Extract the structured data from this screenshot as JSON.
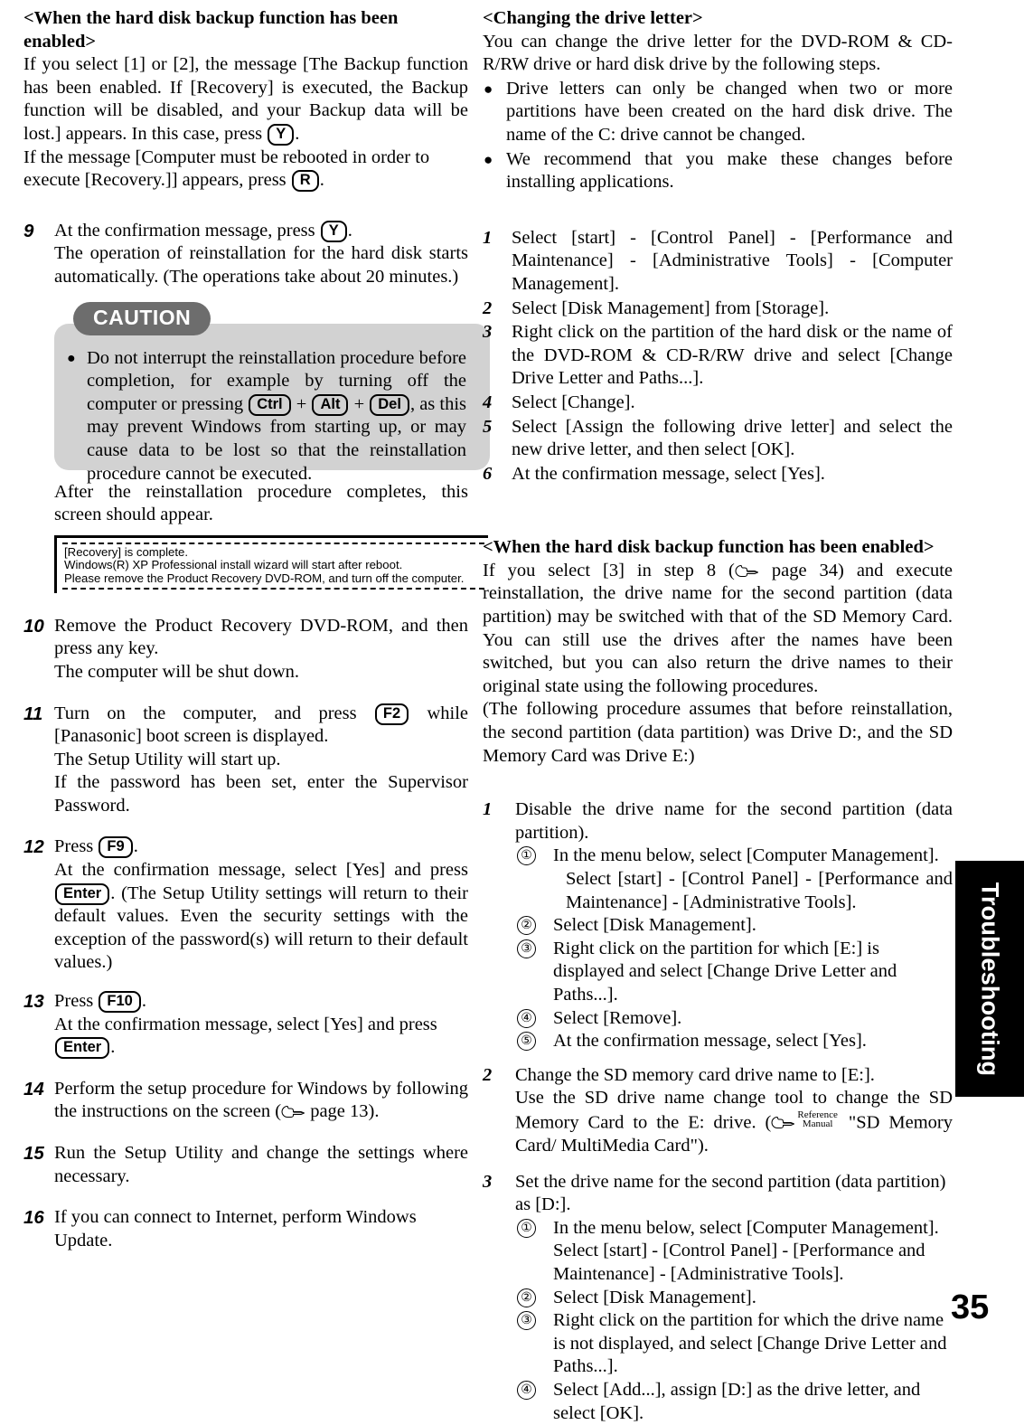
{
  "page": {
    "number": "35",
    "tab_label": "Troubleshooting"
  },
  "left_column": {
    "heading_backup_enabled": "<When the hard disk backup function has been enabled>",
    "p_backup_1a": "If you select [1] or [2], the message [The Backup function has been enabled. If [Recovery] is executed, the Backup function will be disabled, and your Backup data will be lost.] appears.  In this case, press ",
    "p_backup_1_key": "Y",
    "p_backup_1b": ".",
    "p_backup_2a": "If the message [Computer must be rebooted in order to execute [Recovery.]] appears, press ",
    "p_backup_2_key": "R",
    "p_backup_2b": ".",
    "steps": [
      {
        "num": "9",
        "text_a": "At the confirmation message, press ",
        "key": "Y",
        "text_b": ".",
        "text_c": "The operation of reinstallation for the hard disk starts automatically. (The operations take about 20 minutes.)"
      },
      {
        "num": "10",
        "text_a": "Remove the Product Recovery DVD-ROM, and then press any key.",
        "text_b": "The computer will be shut down."
      },
      {
        "num": "11",
        "text_a": "Turn on the computer, and press ",
        "key": "F2",
        "text_b": " while [Panasonic] boot screen is displayed.",
        "text_c": "The Setup Utility will start up.",
        "text_d": "If the password has been set, enter the Supervisor Password."
      },
      {
        "num": "12",
        "text_a": "Press ",
        "key": "F9",
        "text_b": ".",
        "text_c": "At the confirmation message, select [Yes] and press ",
        "key2": "Enter",
        "text_d": ".  (The Setup Utility settings will return to their default values.  Even the security settings with the exception of the password(s) will return to their default values.)"
      },
      {
        "num": "13",
        "text_a": "Press ",
        "key": "F10",
        "text_b": ".",
        "text_c": "At the confirmation message, select [Yes] and press ",
        "key2": "Enter",
        "text_d": "."
      },
      {
        "num": "14",
        "text_a": "Perform the setup procedure for Windows by following the instructions on the screen (",
        "ref_icon": "pointing-hand-icon",
        "text_b": " page 13)."
      },
      {
        "num": "15",
        "text_a": "Run the Setup Utility and change the settings where necessary."
      },
      {
        "num": "16",
        "text_a": "If you can connect to Internet, perform Windows Update."
      }
    ],
    "caution": {
      "badge": "CAUTION",
      "bullet": "●",
      "text_a": "Do not interrupt the reinstallation procedure before completion, for example by turning off the computer or pressing ",
      "key1": "Ctrl",
      "plus1": " + ",
      "key2": "Alt",
      "plus2": " + ",
      "key3": "Del",
      "text_b": ", as this may prevent Windows from starting up, or may cause data to be lost so that the reinstallation procedure cannot be executed."
    },
    "after_caution": "After the reinstallation procedure completes, this screen should appear.",
    "screen_box": {
      "line1": "[Recovery] is complete.",
      "line2": "Windows(R) XP Professional install wizard will start after reboot.",
      "line3": "Please remove the Product Recovery DVD-ROM, and turn off the computer."
    }
  },
  "right_column": {
    "heading_change_drive": "<Changing the drive letter>",
    "p_change_intro": "You can change the drive letter for the DVD-ROM & CD-R/RW drive or hard disk drive by the following steps.",
    "bullets": [
      {
        "dot": "●",
        "text": "Drive letters can only be changed when two or more partitions have been created on the hard disk drive. The name of the C: drive cannot be changed."
      },
      {
        "dot": "●",
        "text": "We recommend that you make these changes before installing applications."
      }
    ],
    "drive_steps": [
      {
        "num": "1",
        "text": "Select [start] - [Control Panel] - [Performance and Maintenance] - [Administrative Tools] - [Computer Management]."
      },
      {
        "num": "2",
        "text": "Select [Disk Management] from [Storage]."
      },
      {
        "num": "3",
        "text": "Right click on the partition of the hard disk or the name of the DVD-ROM & CD-R/RW drive and select [Change Drive Letter and Paths...]."
      },
      {
        "num": "4",
        "text": "Select [Change]."
      },
      {
        "num": "5",
        "text": "Select [Assign the following drive letter] and select the new drive letter, and then select [OK]."
      },
      {
        "num": "6",
        "text": "At the confirmation message, select [Yes]."
      }
    ],
    "heading_backup_enabled": "<When the hard disk backup function has been enabled>",
    "backup_p1a": "If you select [3] in step ",
    "backup_p1_step": "8",
    "backup_p1b": " (",
    "backup_p1_ref": "pointing-hand-icon",
    "backup_p1c": " page 34) and execute reinstallation, the drive name for the second partition (data partition) may be switched with that of the SD Memory Card.  You can still use the drives after the names have been switched, but you can also return the drive names to their original state using the following procedures.",
    "backup_p2": "(The following procedure assumes that before reinstallation, the second partition (data partition) was Drive D:, and the SD Memory Card was Drive E:)",
    "restore_steps": [
      {
        "num": "1",
        "text": "Disable the drive name for the second partition (data partition).",
        "substeps": [
          {
            "cnum": "①",
            "text": "In the menu below, select [Computer Management].",
            "sub": "Select [start] - [Control Panel] - [Performance and Maintenance] - [Administrative Tools]."
          },
          {
            "cnum": "②",
            "text": "Select [Disk Management]."
          },
          {
            "cnum": "③",
            "text": "Right click on the partition for which [E:] is displayed and select [Change Drive Letter and Paths...]."
          },
          {
            "cnum": "④",
            "text": "Select [Remove]."
          },
          {
            "cnum": "⑤",
            "text": "At the confirmation message, select [Yes]."
          }
        ]
      },
      {
        "num": "2",
        "text": "Change the SD memory card drive name to [E:].",
        "text2a": "Use the SD drive name change tool to change the SD Memory Card to the E: drive. (",
        "ref_icon": "pointing-hand-icon",
        "ref_label_line1": "Reference",
        "ref_label_line2": "Manual",
        "text2b": " \"SD Memory Card/ MultiMedia Card\")."
      },
      {
        "num": "3",
        "text": "Set the drive name for the second partition (data partition) as [D:].",
        "substeps": [
          {
            "cnum": "①",
            "text": "In the menu below, select [Computer Management].",
            "sub": "Select [start] - [Control Panel] - [Performance and Maintenance] - [Administrative Tools]."
          },
          {
            "cnum": "②",
            "text": "Select [Disk Management]."
          },
          {
            "cnum": "③",
            "text": "Right click on the partition for which the drive name is not displayed, and select [Change Drive Letter and Paths...]."
          },
          {
            "cnum": "④",
            "text": "Select [Add...], assign [D:] as the drive letter, and select [OK]."
          }
        ]
      }
    ]
  }
}
